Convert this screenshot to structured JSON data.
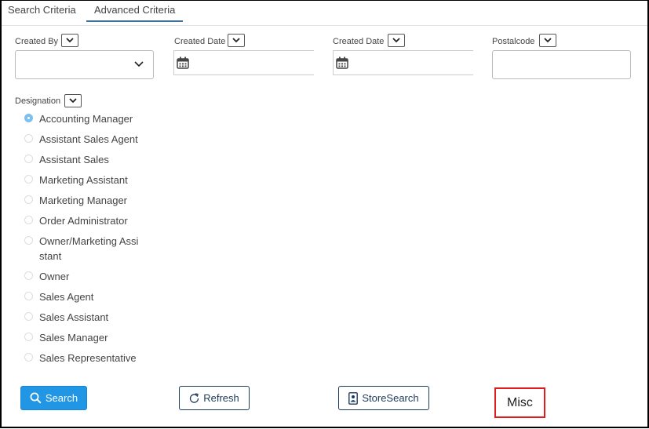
{
  "tabs": [
    "Search Criteria",
    "Advanced Criteria"
  ],
  "filters": {
    "created_by_label": "Created By",
    "created_date_label_1": "Created Date",
    "created_date_label_2": "Created Date",
    "postalcode_label": "Postalcode",
    "designation_label": "Designation"
  },
  "designations": [
    "Accounting Manager",
    "Assistant Sales Agent",
    "Assistant Sales",
    "Marketing Assistant",
    "Marketing Manager",
    "Order Administrator",
    "Owner/Marketing Assi stant",
    "Owner",
    "Sales Agent",
    "Sales Assistant",
    "Sales Manager",
    "Sales Representative"
  ],
  "selected_designation": "Accounting Manager",
  "buttons": {
    "search": "Search",
    "refresh": "Refresh",
    "store_search": "StoreSearch",
    "misc": "Misc"
  },
  "colors": {
    "primary": "#2196e4",
    "outline": "#1c3a5a",
    "highlight": "#e01b1b",
    "radio_selected": "#7cc0ef"
  }
}
